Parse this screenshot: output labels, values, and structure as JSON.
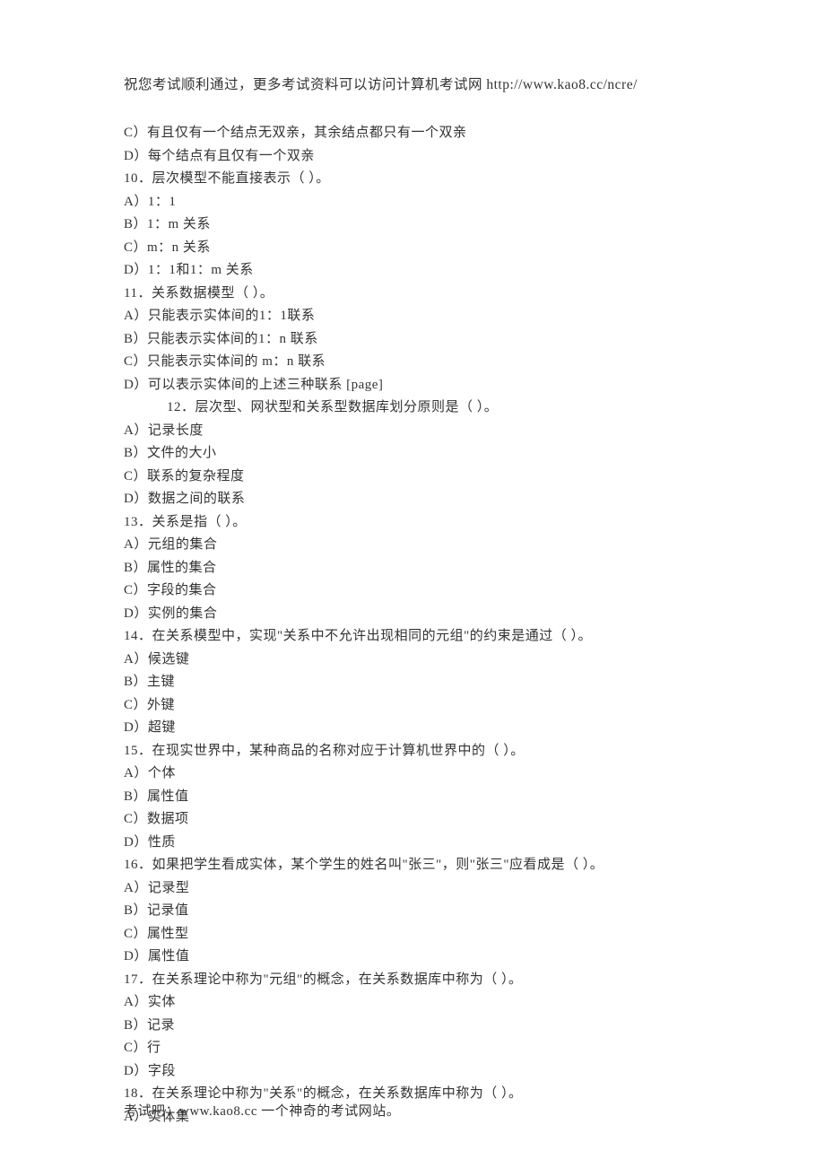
{
  "header": "祝您考试顺利通过，更多考试资料可以访问计算机考试网 http://www.kao8.cc/ncre/",
  "lines": [
    "C）有且仅有一个结点无双亲，其余结点都只有一个双亲",
    "D）每个结点有且仅有一个双亲",
    "10．层次模型不能直接表示（  ）。",
    "A）1：1",
    "B）1：m 关系",
    "C）m：n 关系",
    "D）1：1和1：m 关系",
    "11．关系数据模型（  ）。",
    "A）只能表示实体间的1：1联系",
    "B）只能表示实体间的1：n 联系",
    "C）只能表示实体间的 m：n 联系",
    "D）可以表示实体间的上述三种联系 [page]",
    "12．层次型、网状型和关系型数据库划分原则是（  ）。",
    "A）记录长度",
    "B）文件的大小",
    "C）联系的复杂程度",
    "D）数据之间的联系",
    "13．关系是指（  ）。",
    "A）元组的集合",
    "B）属性的集合",
    "C）字段的集合",
    "D）实例的集合",
    "14．在关系模型中，实现\"关系中不允许出现相同的元组\"的约束是通过（  ）。",
    "A）候选键",
    "B）主键",
    "C）外键",
    "D）超键",
    "15．在现实世界中，某种商品的名称对应于计算机世界中的（  ）。",
    "A）个体",
    "B）属性值",
    "C）数据项",
    "D）性质",
    "16．如果把学生看成实体，某个学生的姓名叫\"张三\"，则\"张三\"应看成是（  ）。",
    "A）记录型",
    "B）记录值",
    "C）属性型",
    "D）属性值",
    "17．在关系理论中称为\"元组\"的概念，在关系数据库中称为（  ）。",
    "A）实体",
    "B）记录",
    "C）行",
    "D）字段",
    "18．在关系理论中称为\"关系\"的概念，在关系数据库中称为（  ）。",
    "A）实体集"
  ],
  "indented_indices": [
    12
  ],
  "footer": "考试吧：www.kao8.cc 一个神奇的考试网站。"
}
